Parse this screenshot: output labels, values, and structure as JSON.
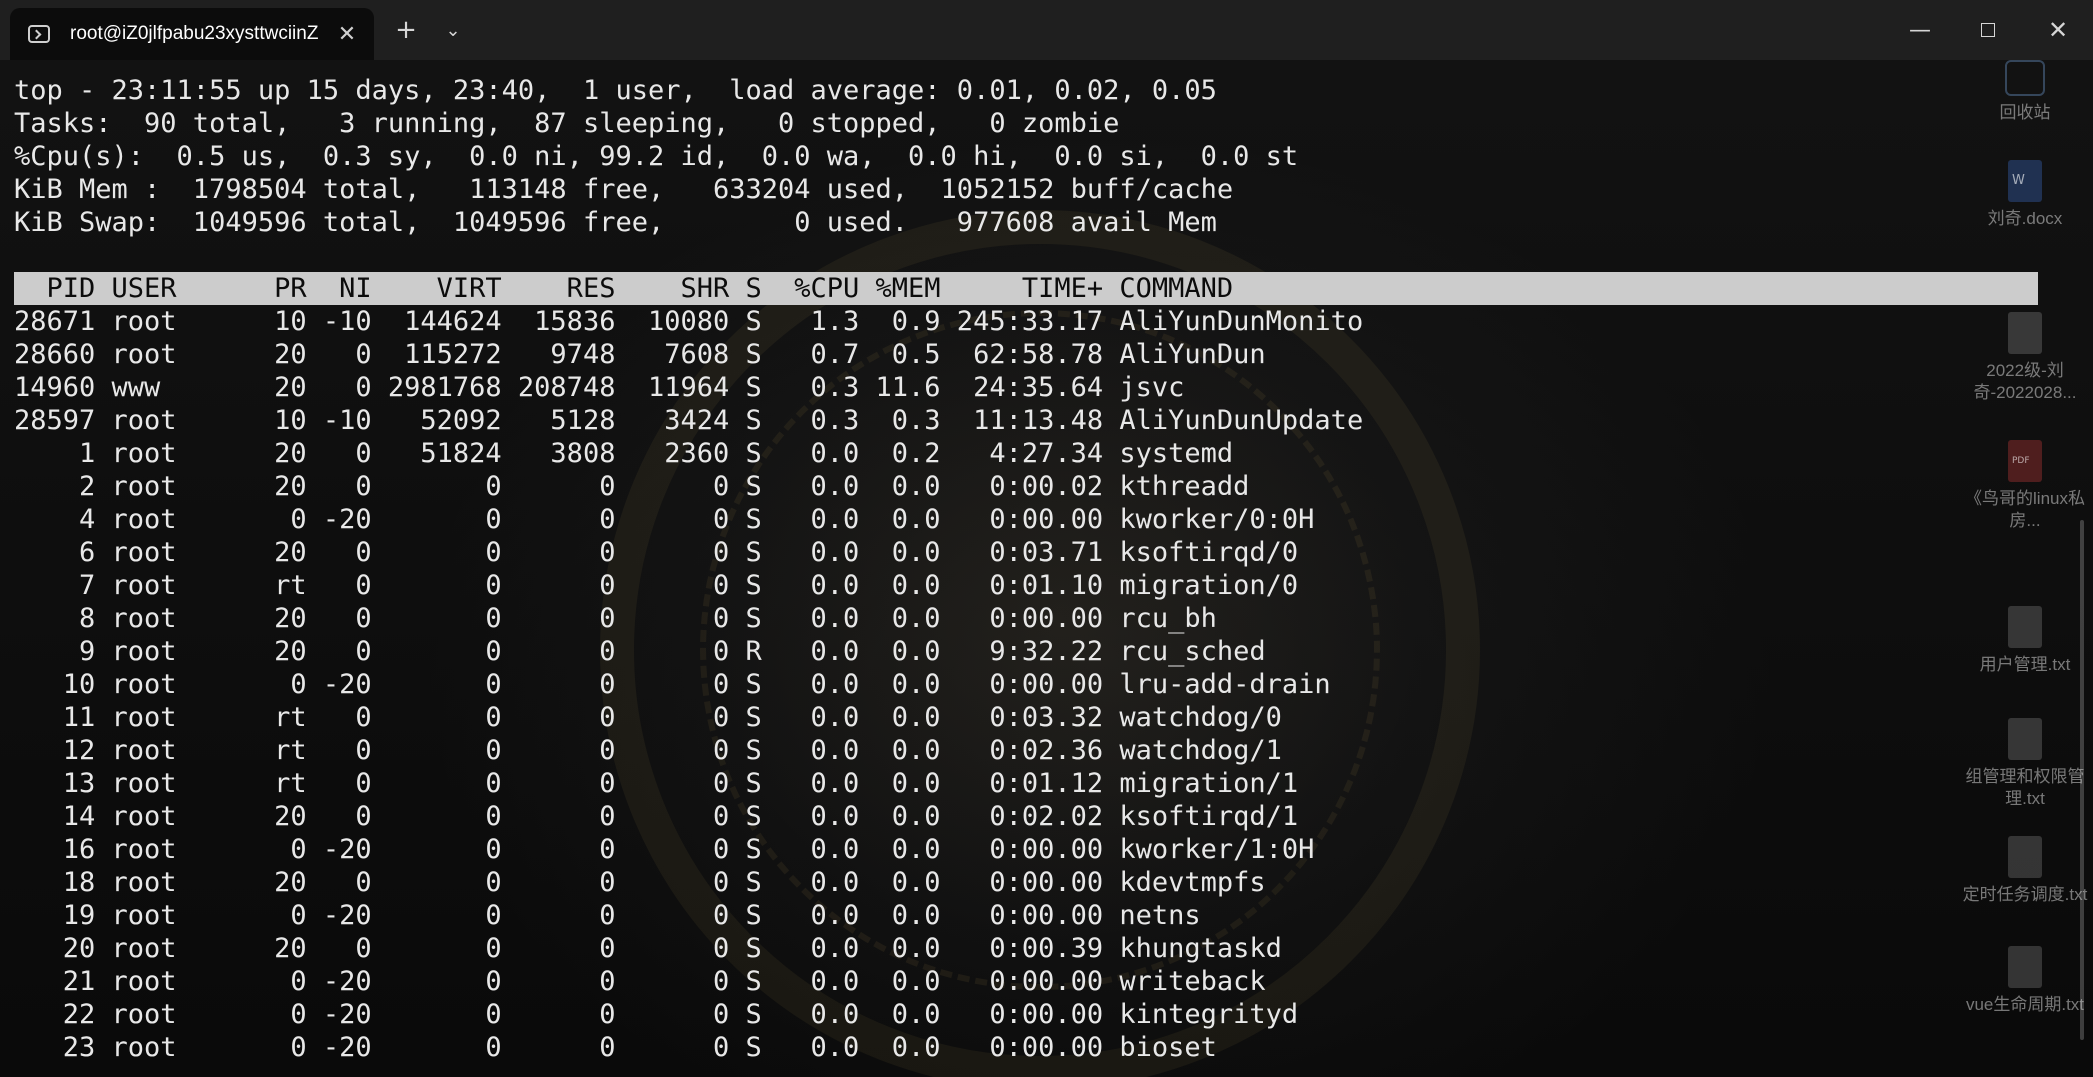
{
  "tab": {
    "title": "root@iZ0jlfpabu23xysttwciinZ",
    "close_glyph": "✕"
  },
  "titlebar": {
    "new_tab_glyph": "+",
    "dropdown_glyph": "⌄",
    "minimize_glyph": "—",
    "close_glyph": "✕"
  },
  "top_summary": [
    "top - 23:11:55 up 15 days, 23:40,  1 user,  load average: 0.01, 0.02, 0.05",
    "Tasks:  90 total,   3 running,  87 sleeping,   0 stopped,   0 zombie",
    "%Cpu(s):  0.5 us,  0.3 sy,  0.0 ni, 99.2 id,  0.0 wa,  0.0 hi,  0.0 si,  0.0 st",
    "KiB Mem :  1798504 total,   113148 free,   633204 used,  1052152 buff/cache",
    "KiB Swap:  1049596 total,  1049596 free,        0 used.   977608 avail Mem"
  ],
  "table_header": "  PID USER      PR  NI    VIRT    RES    SHR S  %CPU %MEM     TIME+ COMMAND                                                    ",
  "processes": [
    {
      "pid": "28671",
      "user": "root",
      "pr": "10",
      "ni": "-10",
      "virt": "144624",
      "res": "15836",
      "shr": "10080",
      "s": "S",
      "cpu": "1.3",
      "mem": "0.9",
      "time": "245:33.17",
      "cmd": "AliYunDunMonito"
    },
    {
      "pid": "28660",
      "user": "root",
      "pr": "20",
      "ni": "0",
      "virt": "115272",
      "res": "9748",
      "shr": "7608",
      "s": "S",
      "cpu": "0.7",
      "mem": "0.5",
      "time": "62:58.78",
      "cmd": "AliYunDun"
    },
    {
      "pid": "14960",
      "user": "www",
      "pr": "20",
      "ni": "0",
      "virt": "2981768",
      "res": "208748",
      "shr": "11964",
      "s": "S",
      "cpu": "0.3",
      "mem": "11.6",
      "time": "24:35.64",
      "cmd": "jsvc"
    },
    {
      "pid": "28597",
      "user": "root",
      "pr": "10",
      "ni": "-10",
      "virt": "52092",
      "res": "5128",
      "shr": "3424",
      "s": "S",
      "cpu": "0.3",
      "mem": "0.3",
      "time": "11:13.48",
      "cmd": "AliYunDunUpdate"
    },
    {
      "pid": "1",
      "user": "root",
      "pr": "20",
      "ni": "0",
      "virt": "51824",
      "res": "3808",
      "shr": "2360",
      "s": "S",
      "cpu": "0.0",
      "mem": "0.2",
      "time": "4:27.34",
      "cmd": "systemd"
    },
    {
      "pid": "2",
      "user": "root",
      "pr": "20",
      "ni": "0",
      "virt": "0",
      "res": "0",
      "shr": "0",
      "s": "S",
      "cpu": "0.0",
      "mem": "0.0",
      "time": "0:00.02",
      "cmd": "kthreadd"
    },
    {
      "pid": "4",
      "user": "root",
      "pr": "0",
      "ni": "-20",
      "virt": "0",
      "res": "0",
      "shr": "0",
      "s": "S",
      "cpu": "0.0",
      "mem": "0.0",
      "time": "0:00.00",
      "cmd": "kworker/0:0H"
    },
    {
      "pid": "6",
      "user": "root",
      "pr": "20",
      "ni": "0",
      "virt": "0",
      "res": "0",
      "shr": "0",
      "s": "S",
      "cpu": "0.0",
      "mem": "0.0",
      "time": "0:03.71",
      "cmd": "ksoftirqd/0"
    },
    {
      "pid": "7",
      "user": "root",
      "pr": "rt",
      "ni": "0",
      "virt": "0",
      "res": "0",
      "shr": "0",
      "s": "S",
      "cpu": "0.0",
      "mem": "0.0",
      "time": "0:01.10",
      "cmd": "migration/0"
    },
    {
      "pid": "8",
      "user": "root",
      "pr": "20",
      "ni": "0",
      "virt": "0",
      "res": "0",
      "shr": "0",
      "s": "S",
      "cpu": "0.0",
      "mem": "0.0",
      "time": "0:00.00",
      "cmd": "rcu_bh"
    },
    {
      "pid": "9",
      "user": "root",
      "pr": "20",
      "ni": "0",
      "virt": "0",
      "res": "0",
      "shr": "0",
      "s": "R",
      "cpu": "0.0",
      "mem": "0.0",
      "time": "9:32.22",
      "cmd": "rcu_sched"
    },
    {
      "pid": "10",
      "user": "root",
      "pr": "0",
      "ni": "-20",
      "virt": "0",
      "res": "0",
      "shr": "0",
      "s": "S",
      "cpu": "0.0",
      "mem": "0.0",
      "time": "0:00.00",
      "cmd": "lru-add-drain"
    },
    {
      "pid": "11",
      "user": "root",
      "pr": "rt",
      "ni": "0",
      "virt": "0",
      "res": "0",
      "shr": "0",
      "s": "S",
      "cpu": "0.0",
      "mem": "0.0",
      "time": "0:03.32",
      "cmd": "watchdog/0"
    },
    {
      "pid": "12",
      "user": "root",
      "pr": "rt",
      "ni": "0",
      "virt": "0",
      "res": "0",
      "shr": "0",
      "s": "S",
      "cpu": "0.0",
      "mem": "0.0",
      "time": "0:02.36",
      "cmd": "watchdog/1"
    },
    {
      "pid": "13",
      "user": "root",
      "pr": "rt",
      "ni": "0",
      "virt": "0",
      "res": "0",
      "shr": "0",
      "s": "S",
      "cpu": "0.0",
      "mem": "0.0",
      "time": "0:01.12",
      "cmd": "migration/1"
    },
    {
      "pid": "14",
      "user": "root",
      "pr": "20",
      "ni": "0",
      "virt": "0",
      "res": "0",
      "shr": "0",
      "s": "S",
      "cpu": "0.0",
      "mem": "0.0",
      "time": "0:02.02",
      "cmd": "ksoftirqd/1"
    },
    {
      "pid": "16",
      "user": "root",
      "pr": "0",
      "ni": "-20",
      "virt": "0",
      "res": "0",
      "shr": "0",
      "s": "S",
      "cpu": "0.0",
      "mem": "0.0",
      "time": "0:00.00",
      "cmd": "kworker/1:0H"
    },
    {
      "pid": "18",
      "user": "root",
      "pr": "20",
      "ni": "0",
      "virt": "0",
      "res": "0",
      "shr": "0",
      "s": "S",
      "cpu": "0.0",
      "mem": "0.0",
      "time": "0:00.00",
      "cmd": "kdevtmpfs"
    },
    {
      "pid": "19",
      "user": "root",
      "pr": "0",
      "ni": "-20",
      "virt": "0",
      "res": "0",
      "shr": "0",
      "s": "S",
      "cpu": "0.0",
      "mem": "0.0",
      "time": "0:00.00",
      "cmd": "netns"
    },
    {
      "pid": "20",
      "user": "root",
      "pr": "20",
      "ni": "0",
      "virt": "0",
      "res": "0",
      "shr": "0",
      "s": "S",
      "cpu": "0.0",
      "mem": "0.0",
      "time": "0:00.39",
      "cmd": "khungtaskd"
    },
    {
      "pid": "21",
      "user": "root",
      "pr": "0",
      "ni": "-20",
      "virt": "0",
      "res": "0",
      "shr": "0",
      "s": "S",
      "cpu": "0.0",
      "mem": "0.0",
      "time": "0:00.00",
      "cmd": "writeback"
    },
    {
      "pid": "22",
      "user": "root",
      "pr": "0",
      "ni": "-20",
      "virt": "0",
      "res": "0",
      "shr": "0",
      "s": "S",
      "cpu": "0.0",
      "mem": "0.0",
      "time": "0:00.00",
      "cmd": "kintegrityd"
    },
    {
      "pid": "23",
      "user": "root",
      "pr": "0",
      "ni": "-20",
      "virt": "0",
      "res": "0",
      "shr": "0",
      "s": "S",
      "cpu": "0.0",
      "mem": "0.0",
      "time": "0:00.00",
      "cmd": "bioset"
    }
  ],
  "desktop_icons": [
    {
      "label": "回收站",
      "kind": "recycle-bin-icon"
    },
    {
      "label": "刘奇.docx",
      "kind": "word-document-icon"
    },
    {
      "label": "2022级-刘奇-2022028...",
      "kind": "file-icon"
    },
    {
      "label": "《鸟哥的linux私房...",
      "kind": "pdf-icon"
    },
    {
      "label": "用户管理.txt",
      "kind": "text-file-icon"
    },
    {
      "label": "组管理和权限管理.txt",
      "kind": "text-file-icon"
    },
    {
      "label": "定时任务调度.txt",
      "kind": "text-file-icon"
    },
    {
      "label": "vue生命周期.txt",
      "kind": "text-file-icon"
    }
  ],
  "colors": {
    "terminal_bg": "#0c0c0c",
    "terminal_fg": "#e8e8e8",
    "header_bg": "#cccccc",
    "titlebar_bg": "#1f1f1f"
  }
}
